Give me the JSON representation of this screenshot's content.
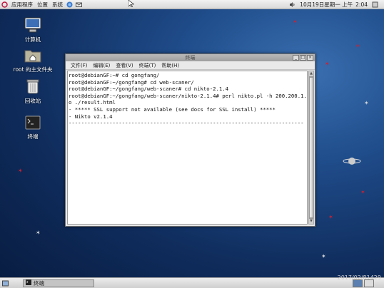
{
  "top_panel": {
    "menus": [
      "应用程序",
      "位置",
      "系统"
    ],
    "date": "10月19日星期一 上午",
    "time": "2:04"
  },
  "desktop": {
    "icons": [
      {
        "label": "计算机",
        "icon": "computer-icon"
      },
      {
        "label": "root 的主文件夹",
        "icon": "home-folder-icon"
      },
      {
        "label": "回收站",
        "icon": "trash-icon"
      },
      {
        "label": "终端",
        "icon": "terminal-icon"
      }
    ]
  },
  "window": {
    "title": "终端",
    "menu": [
      "文件(F)",
      "编辑(E)",
      "查看(V)",
      "终端(T)",
      "帮助(H)"
    ],
    "terminal_lines": [
      "root@debianGF:~# cd gongfang/",
      "root@debianGF:~/gongfang# cd web-scaner/",
      "root@debianGF:~/gongfang/web-scaner# cd nikto-2.1.4",
      "root@debianGF:~/gongfang/web-scaner/nikto-2.1.4# perl nikto.pl -h 200.200.1.43 -",
      "o ./result.html",
      "- ***** SSL support not available (see docs for SSL install) *****",
      "- Nikto v2.1.4",
      "---------------------------------------------------------------------------"
    ]
  },
  "bottom_panel": {
    "task_label": "终端"
  },
  "watermark": "2017/02/81429",
  "colors": {
    "desktop_bg": "#1f4c8a",
    "panel_bg": "#e0e0e0"
  }
}
